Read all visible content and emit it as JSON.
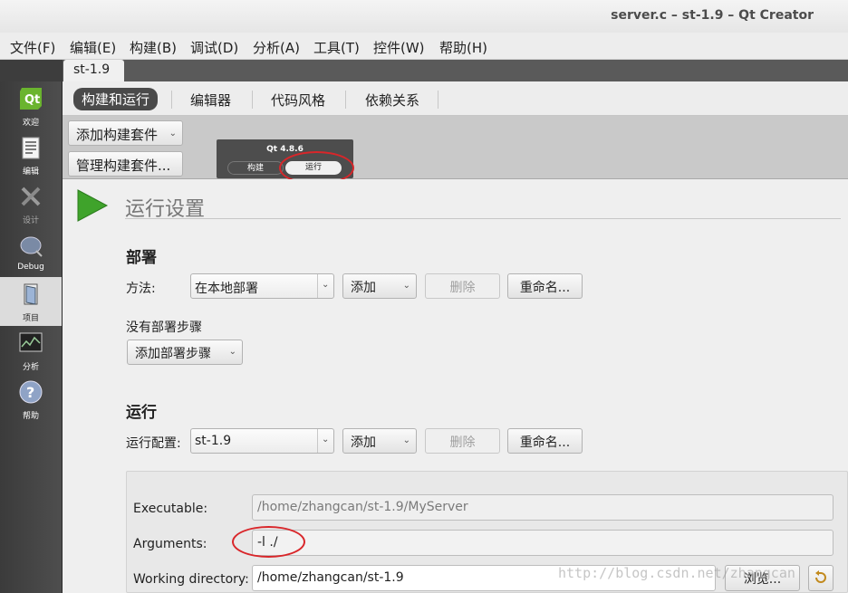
{
  "window": {
    "title": "server.c – st-1.9 – Qt Creator"
  },
  "menu": [
    "文件(F)",
    "编辑(E)",
    "构建(B)",
    "调试(D)",
    "分析(A)",
    "工具(T)",
    "控件(W)",
    "帮助(H)"
  ],
  "project_tab": "st-1.9",
  "sidebar": [
    {
      "label": "欢迎",
      "icon": "qt-logo-icon"
    },
    {
      "label": "编辑",
      "icon": "document-edit-icon"
    },
    {
      "label": "设计",
      "icon": "design-tools-icon"
    },
    {
      "label": "Debug",
      "icon": "debug-bug-icon"
    },
    {
      "label": "项目",
      "icon": "project-folder-icon"
    },
    {
      "label": "分析",
      "icon": "analyze-monitor-icon"
    },
    {
      "label": "帮助",
      "icon": "help-question-icon"
    }
  ],
  "subtabs": [
    "构建和运行",
    "编辑器",
    "代码风格",
    "依赖关系"
  ],
  "kits": {
    "add_kit": "添加构建套件",
    "manage_kit": "管理构建套件...",
    "kit_name": "Qt 4.8.6",
    "build_label": "构建",
    "run_label": "运行"
  },
  "run_settings": {
    "heading": "运行设置",
    "deploy": {
      "title": "部署",
      "method_label": "方法:",
      "method_value": "在本地部署",
      "add": "添加",
      "remove": "删除",
      "rename": "重命名...",
      "no_steps": "没有部署步骤",
      "add_step": "添加部署步骤"
    },
    "run": {
      "title": "运行",
      "config_label": "运行配置:",
      "config_value": "st-1.9",
      "add": "添加",
      "remove": "删除",
      "rename": "重命名..."
    },
    "executable_label": "Executable:",
    "executable_value": "/home/zhangcan/st-1.9/MyServer",
    "arguments_label": "Arguments:",
    "arguments_value": "-l ./",
    "workdir_label": "Working directory:",
    "workdir_value": "/home/zhangcan/st-1.9",
    "browse": "浏览..."
  },
  "watermark": "http://blog.csdn.net/zhangcan"
}
